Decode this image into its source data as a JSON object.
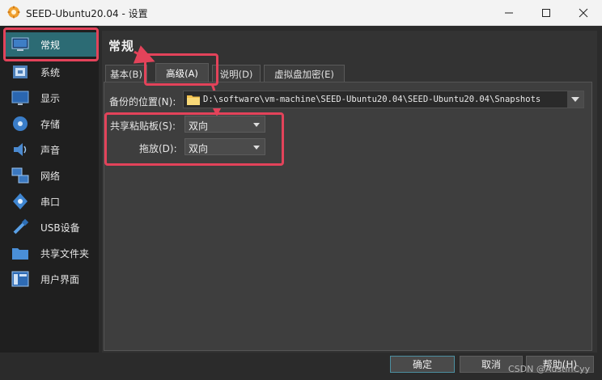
{
  "window": {
    "title": "SEED-Ubuntu20.04 - 设置"
  },
  "sidebar": {
    "items": [
      {
        "label": "常规",
        "icon": "general-monitor-icon"
      },
      {
        "label": "系统",
        "icon": "system-chip-icon"
      },
      {
        "label": "显示",
        "icon": "display-monitor-icon"
      },
      {
        "label": "存储",
        "icon": "storage-disk-icon"
      },
      {
        "label": "声音",
        "icon": "audio-speaker-icon"
      },
      {
        "label": "网络",
        "icon": "network-icon"
      },
      {
        "label": "串口",
        "icon": "serial-port-icon"
      },
      {
        "label": "USB设备",
        "icon": "usb-icon"
      },
      {
        "label": "共享文件夹",
        "icon": "shared-folder-icon"
      },
      {
        "label": "用户界面",
        "icon": "user-interface-icon"
      }
    ]
  },
  "main": {
    "title": "常规",
    "tabs": [
      {
        "label": "基本(B)"
      },
      {
        "label": "高级(A)"
      },
      {
        "label": "说明(D)"
      },
      {
        "label": "虚拟盘加密(E)"
      }
    ],
    "advanced": {
      "snapshot_label": "备份的位置(N):",
      "snapshot_path": "D:\\software\\vm-machine\\SEED-Ubuntu20.04\\SEED-Ubuntu20.04\\Snapshots",
      "clipboard_label": "共享粘贴板(S):",
      "clipboard_value": "双向",
      "dragdrop_label": "拖放(D):",
      "dragdrop_value": "双向"
    }
  },
  "footer": {
    "ok": "确定",
    "cancel": "取消",
    "help": "帮助(H)"
  },
  "watermark": "CSDN @AustinCyy",
  "colors": {
    "accent": "#2c6b74",
    "annotation": "#e3435a",
    "background": "#2b2b2b"
  }
}
